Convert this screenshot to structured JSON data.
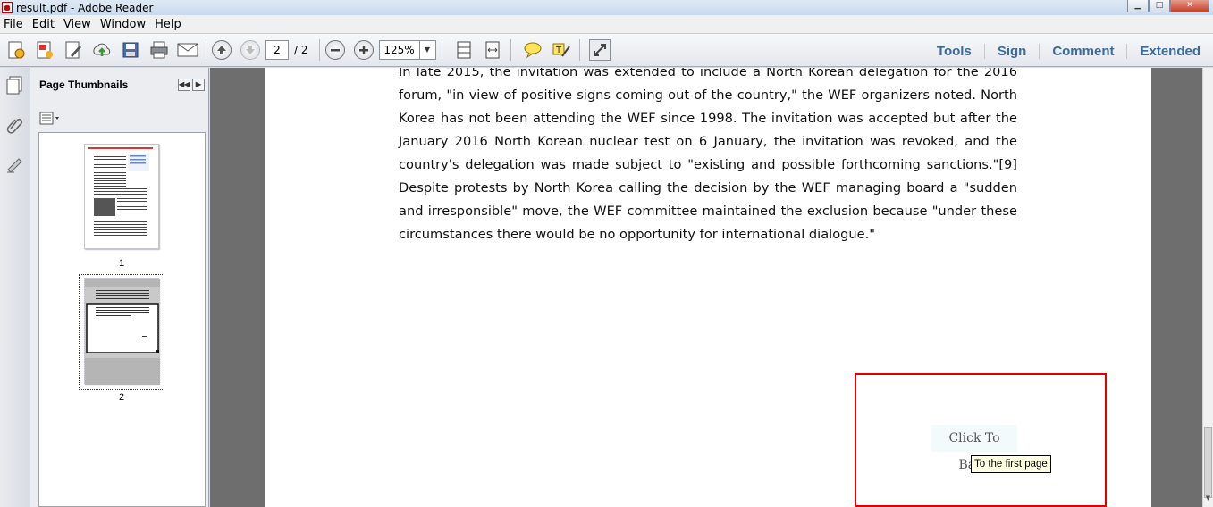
{
  "window": {
    "title": "result.pdf - Adobe Reader",
    "buttons": [
      "minimize",
      "maximize",
      "close"
    ]
  },
  "menu": [
    "File",
    "Edit",
    "View",
    "Window",
    "Help"
  ],
  "toolbar": {
    "page_current": "2",
    "page_total": "/ 2",
    "zoom": "125%",
    "right_links": [
      "Tools",
      "Sign",
      "Comment",
      "Extended"
    ]
  },
  "panel": {
    "title": "Page Thumbnails",
    "thumbnails": [
      {
        "label": "1",
        "selected": false
      },
      {
        "label": "2",
        "selected": true
      }
    ]
  },
  "document": {
    "paragraph": "In late 2015, the invitation was extended to include a North Korean delegation for the 2016 forum, \"in view of positive signs coming out of the country,\" the WEF organizers noted. North Korea has not been attending the WEF since 1998. The invitation was accepted but after the January 2016 North Korean nuclear test on 6 January, the invitation was revoked, and the country's delegation was made subject to \"existing and possible forthcoming sanctions.\"[9] Despite protests by North Korea calling the decision by the WEF managing board a \"sudden and irresponsible\" move, the WEF committee maintained the exclusion because \"under these circumstances there would be no opportunity for international dialogue.\"",
    "link_button": "Click To Back",
    "tooltip": "To the first page",
    "highlight_color": "#e00000"
  }
}
